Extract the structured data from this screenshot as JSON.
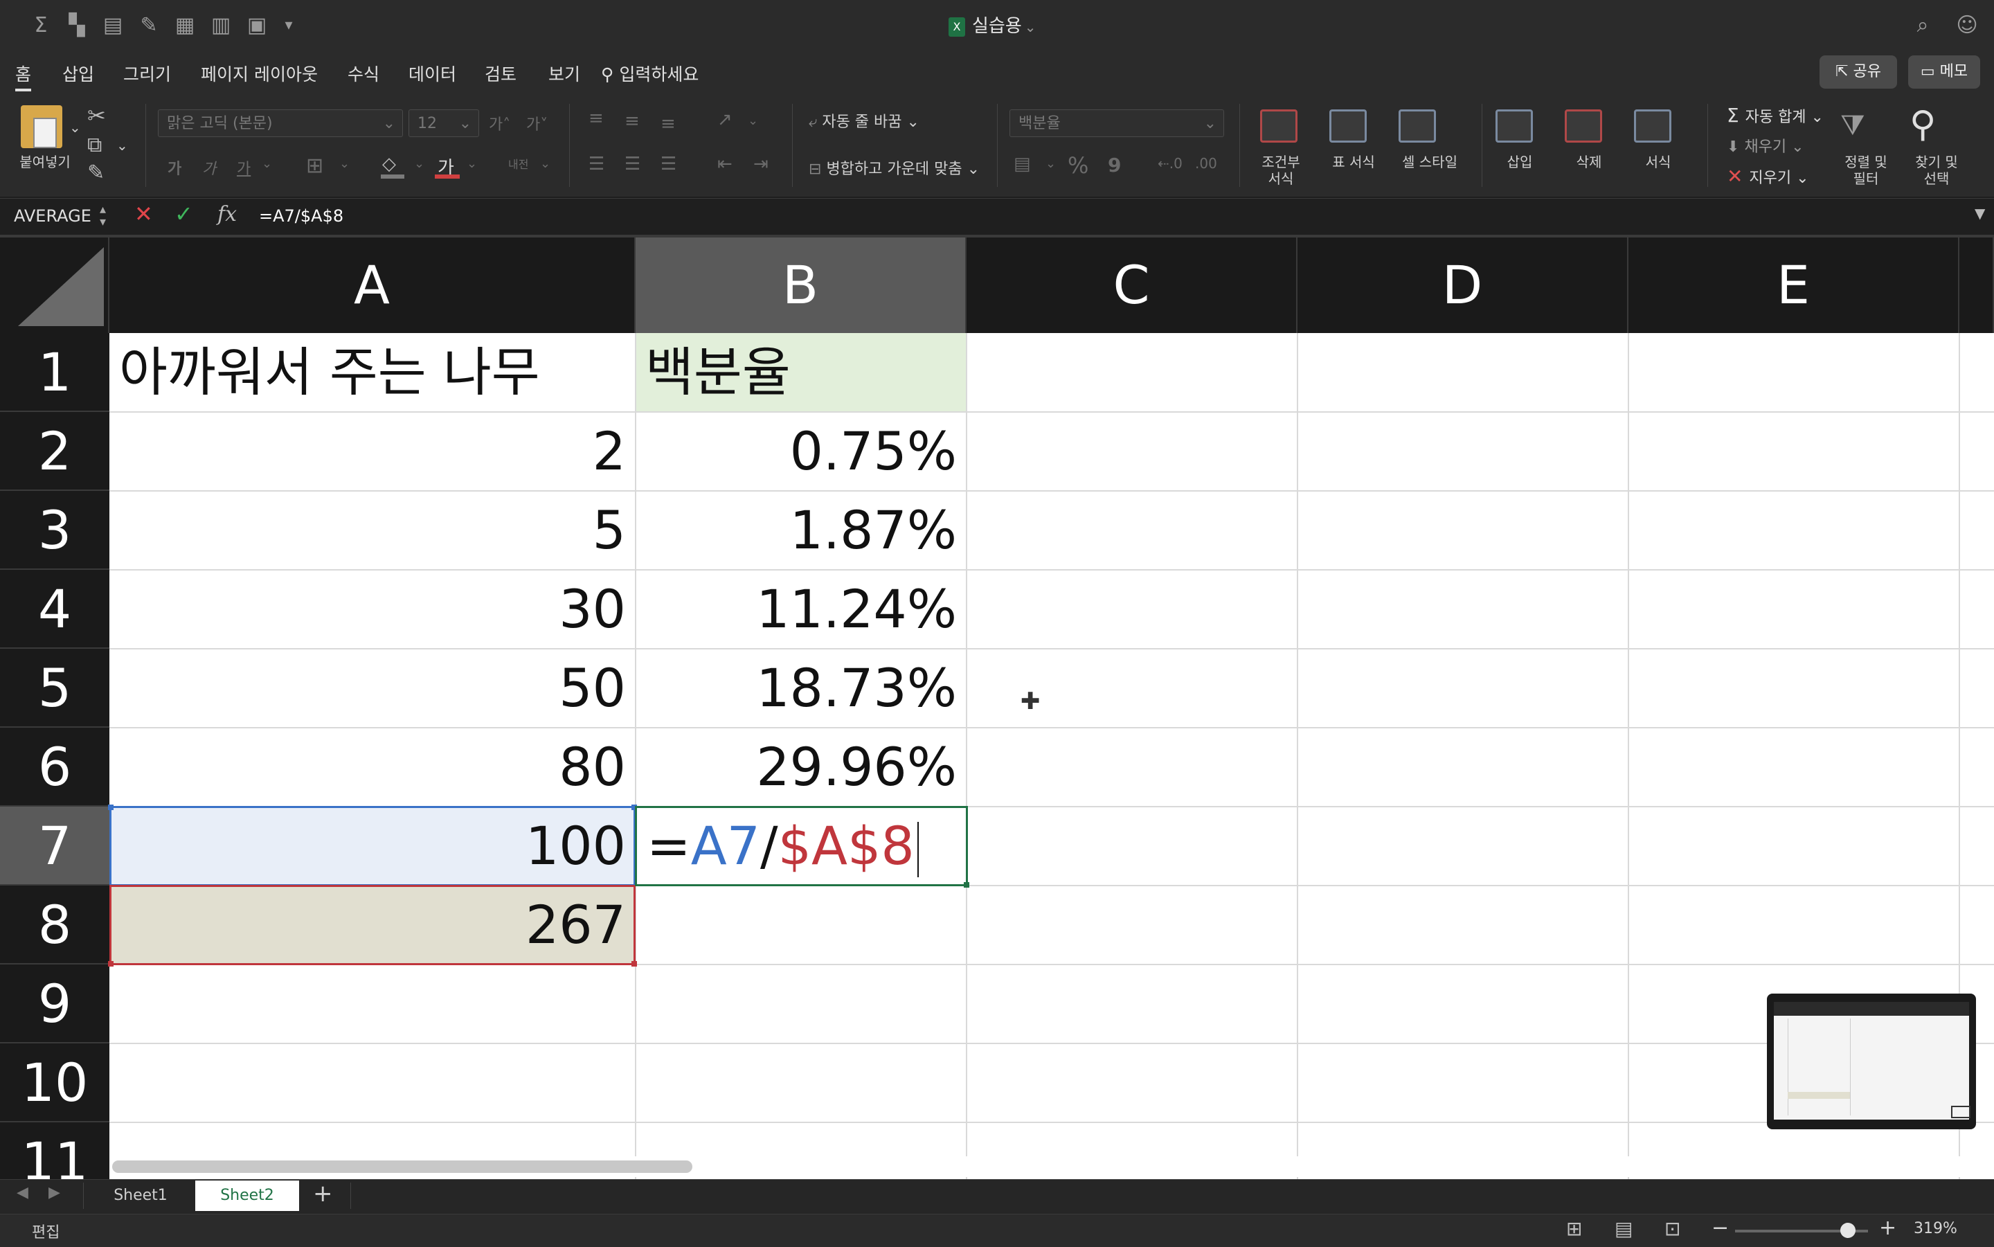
{
  "app": {
    "doc_title": "실습용"
  },
  "ribbon_tabs": [
    {
      "label": "홈"
    },
    {
      "label": "삽입"
    },
    {
      "label": "그리기"
    },
    {
      "label": "페이지 레이아웃"
    },
    {
      "label": "수식"
    },
    {
      "label": "데이터"
    },
    {
      "label": "검토"
    },
    {
      "label": "보기"
    }
  ],
  "tell_me": "입력하세요",
  "share_label": "공유",
  "comments_label": "메모",
  "ribbon": {
    "paste_label": "붙여넣기",
    "font_name": "맑은 고딕 (본문)",
    "font_size": "12",
    "wrap_text": "자동 줄 바꿈",
    "merge_center": "병합하고 가운데 맞춤",
    "number_format": "백분율",
    "conditional_format": [
      "조건부",
      "서식"
    ],
    "format_as_table": "표 서식",
    "cell_styles": "셀 스타일",
    "insert": "삽입",
    "delete": "삭제",
    "format": "서식",
    "autosum": "자동 합계",
    "fill": "채우기",
    "clear": "지우기",
    "sort_filter": [
      "정렬 및",
      "필터"
    ],
    "find_select": [
      "찾기 및",
      "선택"
    ],
    "bold": "가",
    "italic": "가",
    "underline": "가",
    "font_color_glyph": "가",
    "font_grow": "가",
    "font_shrink": "가",
    "border_label": "내전",
    "percent": "%",
    "comma": "9"
  },
  "formula_bar": {
    "name_box": "AVERAGE",
    "fx": "fx",
    "formula": "=A7/$A$8"
  },
  "columns": [
    "A",
    "B",
    "C",
    "D",
    "E"
  ],
  "rows": [
    "1",
    "2",
    "3",
    "4",
    "5",
    "6",
    "7",
    "8",
    "9",
    "10",
    "11"
  ],
  "cells": {
    "A1": "아까워서 주는 나무",
    "B1": "백분율",
    "A2": "2",
    "B2": "0.75%",
    "A3": "5",
    "B3": "1.87%",
    "A4": "30",
    "B4": "11.24%",
    "A5": "50",
    "B5": "18.73%",
    "A6": "80",
    "B6": "29.96%",
    "A7": "100",
    "A8": "267"
  },
  "editing_cell": {
    "eq": "=",
    "ref1": "A7",
    "slash": "/",
    "ref2": "$A$8"
  },
  "colors": {
    "ref1": "#3a72c8",
    "ref2": "#c0363c",
    "header_fill": "#e2efda",
    "a7_fill": "#e8eef8",
    "a8_fill": "#e1dfd0",
    "active_border": "#217346"
  },
  "sheets": [
    {
      "name": "Sheet1"
    },
    {
      "name": "Sheet2"
    }
  ],
  "active_sheet": "Sheet2",
  "status": {
    "mode": "편집",
    "zoom": "319%"
  }
}
